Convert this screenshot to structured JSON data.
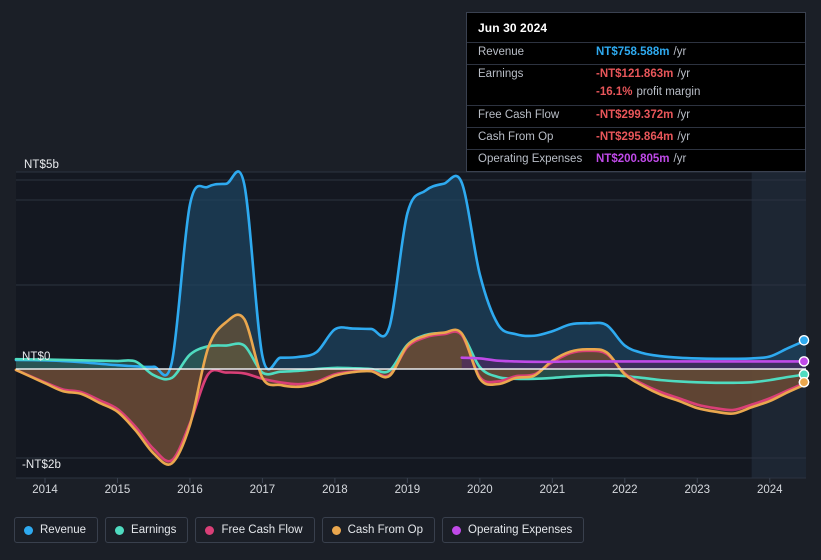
{
  "chart_data": {
    "type": "area",
    "title": "",
    "xlabel": "",
    "ylabel": "",
    "currency": "NT$",
    "grid": true,
    "legend_position": "bottom",
    "x": [
      2013.6,
      2014,
      2014.25,
      2014.5,
      2014.75,
      2015,
      2015.25,
      2015.5,
      2015.75,
      2016,
      2016.25,
      2016.5,
      2016.75,
      2017,
      2017.25,
      2017.5,
      2017.75,
      2018,
      2018.25,
      2018.5,
      2018.75,
      2019,
      2019.25,
      2019.5,
      2019.75,
      2020,
      2020.25,
      2020.5,
      2020.75,
      2021,
      2021.25,
      2021.5,
      2021.75,
      2022,
      2022.25,
      2022.5,
      2022.75,
      2023,
      2023.25,
      2023.5,
      2023.75,
      2024,
      2024.25,
      2024.5
    ],
    "xtick_labels": [
      "2014",
      "2015",
      "2016",
      "2017",
      "2018",
      "2019",
      "2020",
      "2021",
      "2022",
      "2023",
      "2024"
    ],
    "xticks": [
      2014,
      2015,
      2016,
      2017,
      2018,
      2019,
      2020,
      2021,
      2022,
      2023,
      2024
    ],
    "ytick_labels": [
      "NT$5b",
      "NT$0",
      "-NT$2b"
    ],
    "yticks": [
      5,
      0,
      -2
    ],
    "ylim": [
      -2.45,
      5.6
    ],
    "units": "NT$ billions",
    "series": [
      {
        "name": "Revenue",
        "color": "#2eaaf0",
        "fill": "#1d4460",
        "values": [
          0.24,
          0.23,
          0.21,
          0.18,
          0.14,
          0.1,
          0.07,
          0.06,
          0.18,
          4.35,
          4.82,
          4.9,
          4.88,
          0.34,
          0.3,
          0.32,
          0.45,
          1.05,
          1.07,
          1.06,
          1.1,
          4.12,
          4.72,
          4.9,
          4.93,
          2.5,
          1.18,
          0.92,
          0.88,
          1.0,
          1.18,
          1.21,
          1.16,
          0.62,
          0.42,
          0.34,
          0.3,
          0.28,
          0.27,
          0.27,
          0.28,
          0.33,
          0.55,
          0.76
        ]
      },
      {
        "name": "Earnings",
        "color": "#4fdbc0",
        "fill": "#2e5f58",
        "values": [
          0.26,
          0.25,
          0.24,
          0.23,
          0.22,
          0.21,
          0.2,
          -0.14,
          -0.2,
          0.38,
          0.6,
          0.62,
          0.62,
          -0.08,
          -0.06,
          -0.04,
          0.0,
          0.03,
          0.02,
          0.0,
          -0.04,
          0.64,
          0.9,
          0.95,
          0.92,
          0.05,
          -0.18,
          -0.22,
          -0.22,
          -0.2,
          -0.17,
          -0.15,
          -0.14,
          -0.16,
          -0.2,
          -0.25,
          -0.28,
          -0.3,
          -0.31,
          -0.31,
          -0.3,
          -0.25,
          -0.18,
          -0.12
        ]
      },
      {
        "name": "Free Cash Flow",
        "color": "#d93f77",
        "fill": "#55222f",
        "values": [
          -0.02,
          -0.3,
          -0.46,
          -0.52,
          -0.7,
          -0.9,
          -1.3,
          -1.8,
          -2.05,
          -1.22,
          -0.12,
          -0.08,
          -0.1,
          -0.22,
          -0.3,
          -0.34,
          -0.28,
          -0.12,
          -0.06,
          -0.04,
          -0.14,
          0.58,
          0.84,
          0.92,
          0.9,
          -0.18,
          -0.28,
          -0.16,
          -0.12,
          0.18,
          0.42,
          0.48,
          0.4,
          -0.1,
          -0.34,
          -0.52,
          -0.66,
          -0.8,
          -0.88,
          -0.92,
          -0.8,
          -0.66,
          -0.48,
          -0.3
        ]
      },
      {
        "name": "Cash From Op",
        "color": "#eaa74e",
        "fill": "#6b5336",
        "values": [
          -0.02,
          -0.32,
          -0.5,
          -0.56,
          -0.76,
          -0.96,
          -1.38,
          -1.9,
          -2.12,
          -1.26,
          0.55,
          1.24,
          1.32,
          -0.2,
          -0.36,
          -0.4,
          -0.32,
          -0.15,
          -0.07,
          -0.05,
          -0.16,
          0.62,
          0.88,
          0.96,
          0.94,
          -0.22,
          -0.34,
          -0.2,
          -0.15,
          0.22,
          0.46,
          0.52,
          0.44,
          -0.12,
          -0.38,
          -0.58,
          -0.72,
          -0.88,
          -0.96,
          -1.0,
          -0.86,
          -0.72,
          -0.52,
          -0.34
        ]
      },
      {
        "name": "Operating Expenses",
        "color": "#c04ae8",
        "fill": "#4a2a63",
        "values": [
          null,
          null,
          null,
          null,
          null,
          null,
          null,
          null,
          null,
          null,
          null,
          null,
          null,
          null,
          null,
          null,
          null,
          null,
          null,
          null,
          null,
          null,
          null,
          null,
          0.3,
          0.28,
          0.22,
          0.2,
          0.19,
          0.19,
          0.2,
          0.2,
          0.2,
          0.2,
          0.2,
          0.2,
          0.2,
          0.2,
          0.2,
          0.2,
          0.2,
          0.2,
          0.2,
          0.2
        ]
      }
    ],
    "endpoints": [
      {
        "name": "Revenue",
        "value": 0.759,
        "color": "#2eaaf0"
      },
      {
        "name": "Operating Expenses",
        "value": 0.201,
        "color": "#c04ae8"
      },
      {
        "name": "Earnings",
        "value": -0.122,
        "color": "#4fdbc0"
      },
      {
        "name": "Free Cash Flow",
        "value": -0.299,
        "color": "#d93f77"
      },
      {
        "name": "Cash From Op",
        "value": -0.296,
        "color": "#eaa74e"
      }
    ],
    "highlight_band": {
      "from": 2023.75,
      "to": 2024.5
    }
  },
  "tooltip": {
    "date": "Jun 30 2024",
    "rows": [
      {
        "label": "Revenue",
        "value": "NT$758.588m",
        "unit": "/yr",
        "color": "#2eaaf0"
      },
      {
        "label": "Earnings",
        "value": "-NT$121.863m",
        "unit": "/yr",
        "color": "#e8565a"
      },
      {
        "label": "",
        "value": "-16.1%",
        "unit": "profit margin",
        "color": "#e8565a",
        "sub": true
      },
      {
        "label": "Free Cash Flow",
        "value": "-NT$299.372m",
        "unit": "/yr",
        "color": "#e8565a"
      },
      {
        "label": "Cash From Op",
        "value": "-NT$295.864m",
        "unit": "/yr",
        "color": "#e8565a"
      },
      {
        "label": "Operating Expenses",
        "value": "NT$200.805m",
        "unit": "/yr",
        "color": "#c04ae8"
      }
    ]
  },
  "legend": {
    "items": [
      {
        "label": "Revenue",
        "color": "#2eaaf0"
      },
      {
        "label": "Earnings",
        "color": "#4fdbc0"
      },
      {
        "label": "Free Cash Flow",
        "color": "#d93f77"
      },
      {
        "label": "Cash From Op",
        "color": "#eaa74e"
      },
      {
        "label": "Operating Expenses",
        "color": "#c04ae8"
      }
    ]
  },
  "axes": {
    "y_top_label": "NT$5b",
    "y_zero_label": "NT$0",
    "y_bottom_label": "-NT$2b"
  }
}
